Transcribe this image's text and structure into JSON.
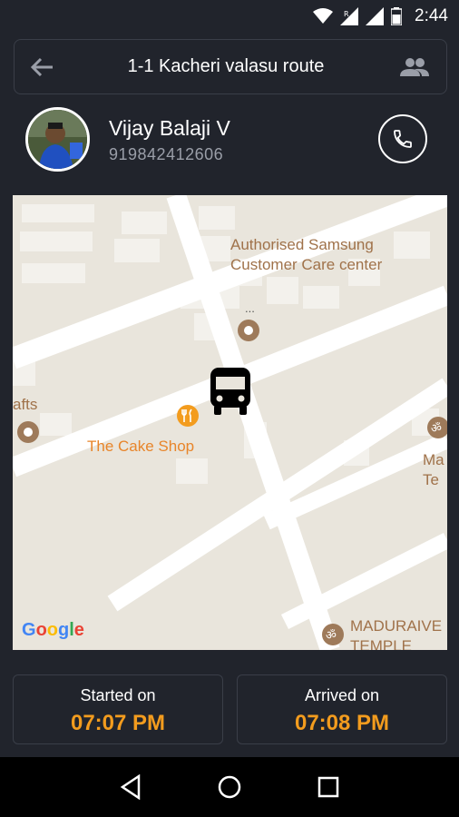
{
  "status_bar": {
    "time": "2:44"
  },
  "header": {
    "title": "1-1 Kacheri valasu route"
  },
  "driver": {
    "name": "Vijay Balaji V",
    "phone": "919842412606"
  },
  "map": {
    "labels": {
      "samsung": "Authorised Samsung\nCustomer Care center",
      "ellipsis": "...",
      "afts": "afts",
      "cake_shop": "The Cake Shop",
      "ma": "Ma",
      "te": "Te",
      "maduraive": "MADURAIVE",
      "temple": "TEMPLE"
    },
    "attribution": "Google"
  },
  "trip": {
    "started_label": "Started on",
    "started_time": "07:07 PM",
    "arrived_label": "Arrived on",
    "arrived_time": "07:08 PM"
  },
  "colors": {
    "accent": "#f39c1e",
    "background": "#21242c",
    "map_bg": "#e9e5dc"
  }
}
